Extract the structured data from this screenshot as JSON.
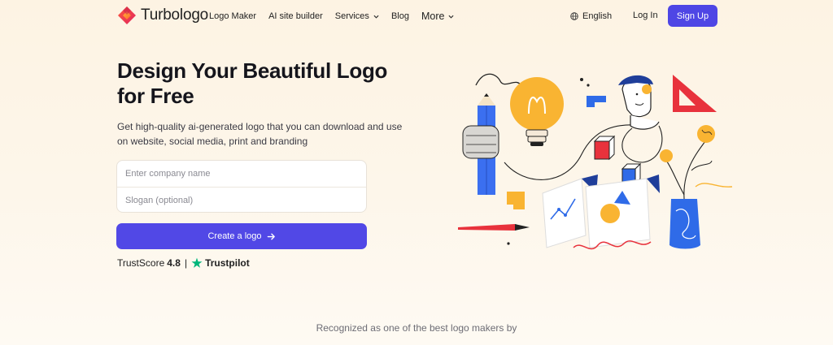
{
  "nav": {
    "brand": "Turbologo",
    "links": [
      {
        "label": "Logo Maker"
      },
      {
        "label": "AI site builder"
      },
      {
        "label": "Services",
        "dropdown": true
      },
      {
        "label": "Blog"
      },
      {
        "label": "More",
        "dropdown": true
      }
    ],
    "language": "English",
    "login": "Log In",
    "signup": "Sign Up"
  },
  "hero": {
    "title_line1": "Design Your Beautiful Logo",
    "title_line2": "for Free",
    "subtitle_line1": "Get high-quality ai-generated logo that you can download and use",
    "subtitle_line2": "on website, social media, print and branding",
    "company_placeholder": "Enter company name",
    "slogan_placeholder": "Slogan (optional)",
    "cta": "Create a logo",
    "trust_label": "TrustScore",
    "trust_score": "4.8",
    "trust_separator": "|",
    "trust_brand": "Trustpilot"
  },
  "footer": {
    "recognized": "Recognized as one of the best logo makers by"
  },
  "colors": {
    "accent": "#4e46e5",
    "background": "#fdf3e3",
    "trustpilot_green": "#00b67a"
  },
  "icons": [
    "turbologo-logo-icon",
    "chevron-down-icon",
    "globe-icon",
    "arrow-right-icon",
    "trustpilot-star-icon"
  ]
}
